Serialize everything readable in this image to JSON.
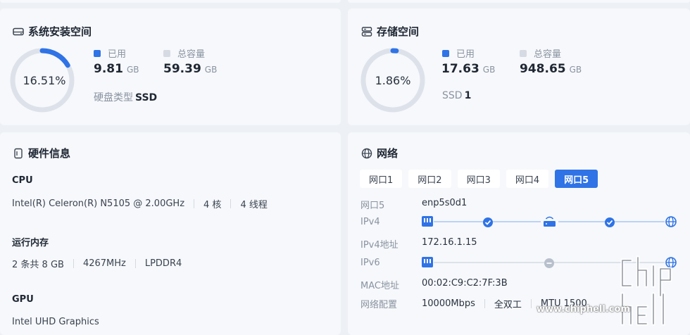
{
  "system_storage": {
    "title": "系统安装空间",
    "percent_text": "16.51%",
    "percent": 16.51,
    "used_label": "已用",
    "used_value": "9.81",
    "used_unit": "GB",
    "total_label": "总容量",
    "total_value": "59.39",
    "total_unit": "GB",
    "disk_type_label": "硬盘类型",
    "disk_type_value": "SSD"
  },
  "storage": {
    "title": "存储空间",
    "percent_text": "1.86%",
    "percent": 1.86,
    "used_label": "已用",
    "used_value": "17.63",
    "used_unit": "GB",
    "total_label": "总容量",
    "total_value": "948.65",
    "total_unit": "GB",
    "ssd_label": "SSD",
    "ssd_count": "1"
  },
  "hardware": {
    "title": "硬件信息",
    "cpu_label": "CPU",
    "cpu_model": "Intel(R) Celeron(R) N5105 @ 2.00GHz",
    "cpu_cores": "4 核",
    "cpu_threads": "4 线程",
    "ram_label": "运行内存",
    "ram_size": "2 条共 8 GB",
    "ram_speed": "4267MHz",
    "ram_type": "LPDDR4",
    "gpu_label": "GPU",
    "gpu_model": "Intel UHD Graphics"
  },
  "network": {
    "title": "网络",
    "tabs": [
      "网口1",
      "网口2",
      "网口3",
      "网口4",
      "网口5"
    ],
    "active_tab": 4,
    "port_label": "网口5",
    "port_value": "enp5s0d1",
    "ipv4_label": "IPv4",
    "ipv4_addr_label": "IPv4地址",
    "ipv4_addr_value": "172.16.1.15",
    "ipv6_label": "IPv6",
    "mac_label": "MAC地址",
    "mac_value": "00:02:C9:C2:7F:3B",
    "config_label": "网络配置",
    "config_speed": "10000Mbps",
    "config_duplex": "全双工",
    "config_mtu": "MTU 1500"
  },
  "watermark": "www.chiphell.com",
  "colors": {
    "accent": "#2f73e6",
    "ring_track": "#dde2ea",
    "legend_total": "#d6dbe3"
  }
}
